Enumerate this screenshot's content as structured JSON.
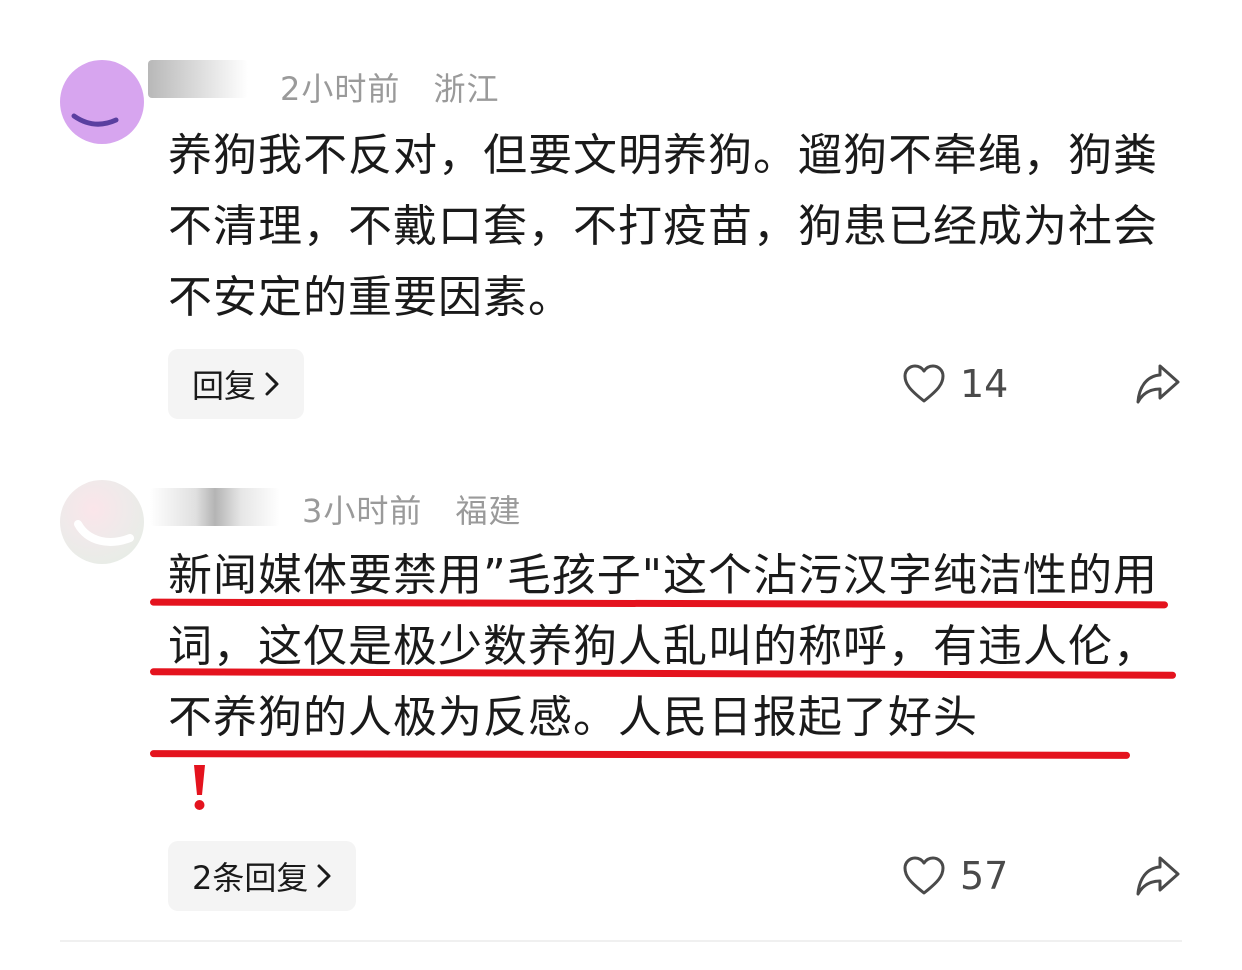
{
  "comments": [
    {
      "time": "2小时前",
      "location": "浙江",
      "text": "养狗我不反对，但要文明养狗。遛狗不牵绳，狗粪不清理，不戴口套，不打疫苗，狗患已经成为社会不安定的重要因素。",
      "reply_label": "回复",
      "likes": "14",
      "avatar_color": "#d7a5ef"
    },
    {
      "time": "3小时前",
      "location": "福建",
      "text": "新闻媒体要禁用”毛孩子\"这个沾污汉字纯洁性的用词，这仅是极少数养狗人乱叫的称呼，有违人伦，不养狗的人极为反感。人民日报起了好头",
      "reply_label": "2条回复",
      "likes": "57",
      "avatar_color": "#efeaea"
    }
  ],
  "icons": {
    "like": "heart-outline-icon",
    "share": "share-arrow-icon",
    "reply": "chevron-right-icon"
  },
  "colors": {
    "annotation_red": "#e4131e",
    "meta_gray": "#9a9a9a",
    "button_bg": "#f4f4f4"
  }
}
